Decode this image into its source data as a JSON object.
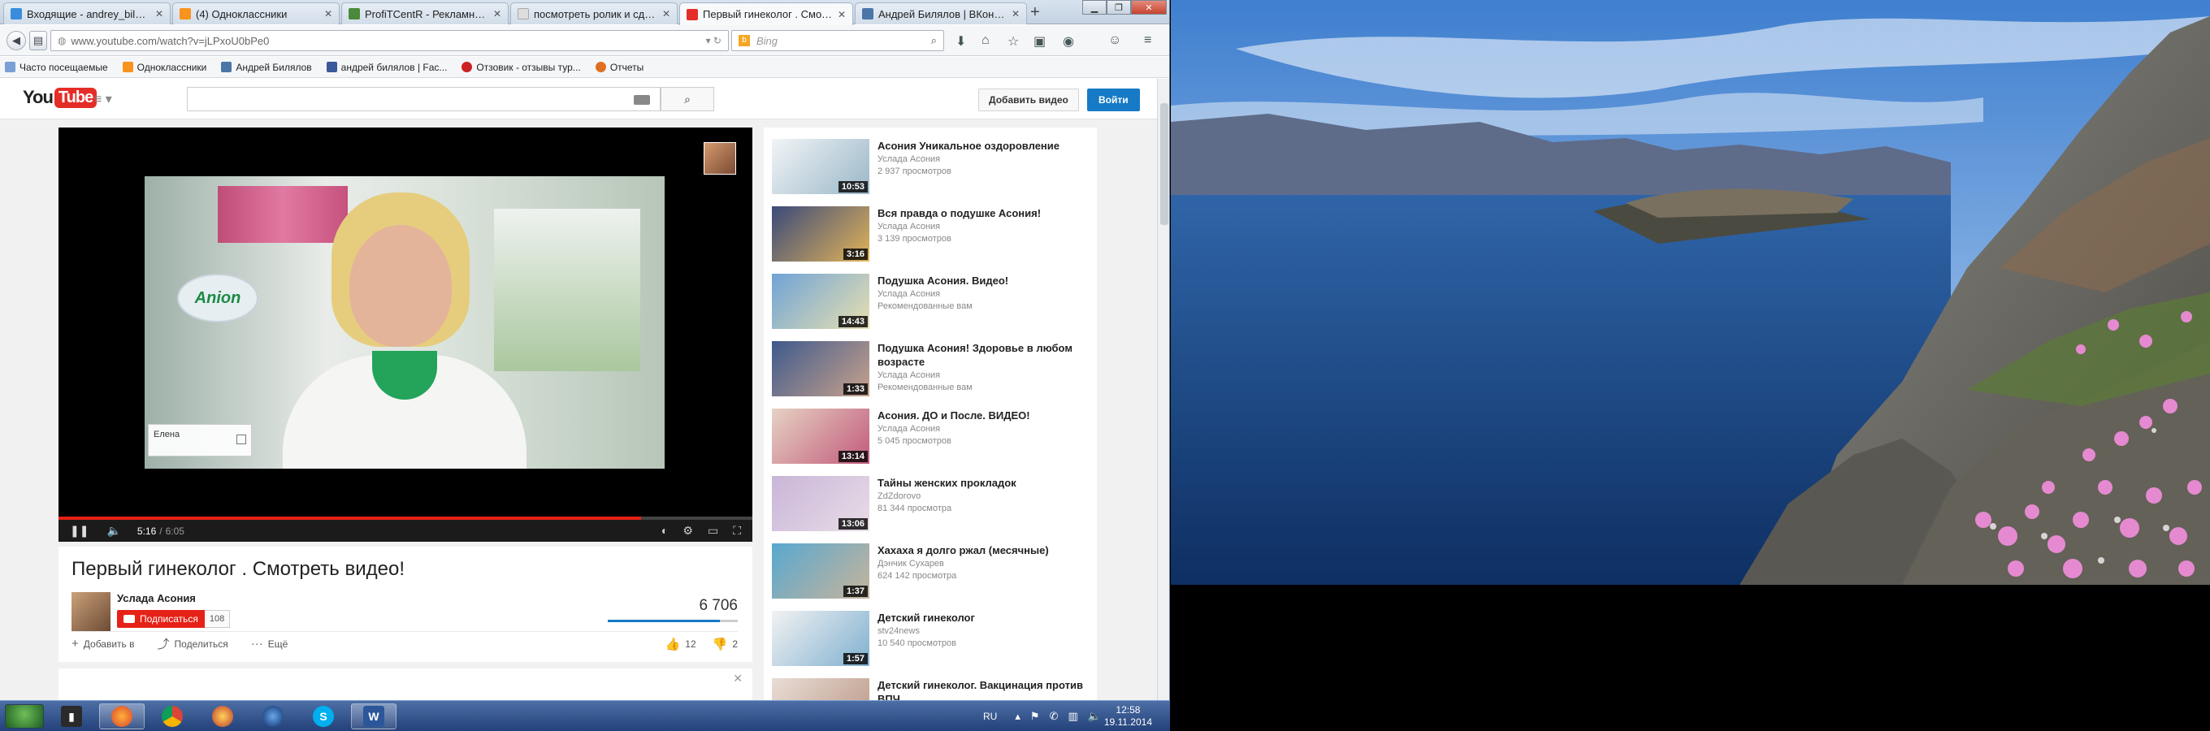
{
  "browser": {
    "tabs": [
      {
        "label": "Входящие - andrey_bilyal...",
        "color": "#3a8ddc"
      },
      {
        "label": "(4) Одноклассники",
        "color": "#f7931e"
      },
      {
        "label": "ProfiTCentR - Рекламное ...",
        "color": "#4a8a3a"
      },
      {
        "label": "посмотреть ролик и сдел...",
        "color": "#dddddd"
      },
      {
        "label": "Первый гинеколог . Смотр...",
        "color": "#e52d27"
      },
      {
        "label": "Андрей Билялов | ВКонта...",
        "color": "#4a76a8"
      }
    ],
    "active_tab": 4,
    "url": "www.youtube.com/watch?v=jLPxoU0bPe0",
    "search_placeholder": "Bing",
    "bookmarks": [
      {
        "label": "Часто посещаемые",
        "color": "#7aa0d6"
      },
      {
        "label": "Одноклассники",
        "color": "#f7931e"
      },
      {
        "label": "Андрей Билялов",
        "color": "#4a76a8"
      },
      {
        "label": "андрей билялов | Fac...",
        "color": "#3b5998"
      },
      {
        "label": "Отзовик - отзывы тур...",
        "color": "#cc2222"
      },
      {
        "label": "Отчеты",
        "color": "#e07020"
      }
    ]
  },
  "youtube": {
    "logo_you": "You",
    "logo_tube": "Tube",
    "add_video_label": "Добавить видео",
    "signin_label": "Войти",
    "player": {
      "overlay_name": "Елена",
      "time_current": "5:16",
      "time_separator": "/",
      "time_total": "6:05",
      "progress": 0.84
    },
    "video": {
      "title": "Первый гинеколог . Смотреть видео!",
      "channel": "Услада Асония",
      "subscribe_label": "Подписаться",
      "subscriber_count": "108",
      "views": "6 706",
      "add_to_label": "Добавить в",
      "share_label": "Поделиться",
      "more_label": "Ещё",
      "likes": "12",
      "dislikes": "2",
      "like_ratio": 0.86
    },
    "related": [
      {
        "title": "Асония Уникальное оздоровление",
        "channel": "Услада Асония",
        "views": "2 937 просмотров",
        "duration": "10:53"
      },
      {
        "title": "Вся правда о подушке Асония!",
        "channel": "Услада Асония",
        "views": "3 139 просмотров",
        "duration": "3:16"
      },
      {
        "title": "Подушка Асония. Видео!",
        "channel": "Услада Асония",
        "views": "Рекомендованные вам",
        "duration": "14:43"
      },
      {
        "title": "Подушка Асония! Здоровье в любом возрасте",
        "channel": "Услада Асония",
        "views": "Рекомендованные вам",
        "duration": "1:33"
      },
      {
        "title": "Асония. ДО и После. ВИДЕО!",
        "channel": "Услада Асония",
        "views": "5 045 просмотров",
        "duration": "13:14"
      },
      {
        "title": "Тайны женских прокладок",
        "channel": "ZdZdorovo",
        "views": "81 344 просмотра",
        "duration": "13:06"
      },
      {
        "title": "Хахаха я долго ржал (месячные)",
        "channel": "Дэнчик Сухарев",
        "views": "624 142 просмотра",
        "duration": "1:37"
      },
      {
        "title": "Детский гинеколог",
        "channel": "stv24news",
        "views": "10 540 просмотров",
        "duration": "1:57"
      },
      {
        "title": "Детский гинеколог. Вакцинация против ВПЧ",
        "channel": "",
        "views": "",
        "duration": ""
      }
    ]
  },
  "taskbar": {
    "lang": "RU",
    "time": "12:58",
    "date": "19.11.2014"
  },
  "colors": {
    "youtube_red": "#e52d27",
    "signin_blue": "#167ac6",
    "progress_red": "#e62117"
  }
}
